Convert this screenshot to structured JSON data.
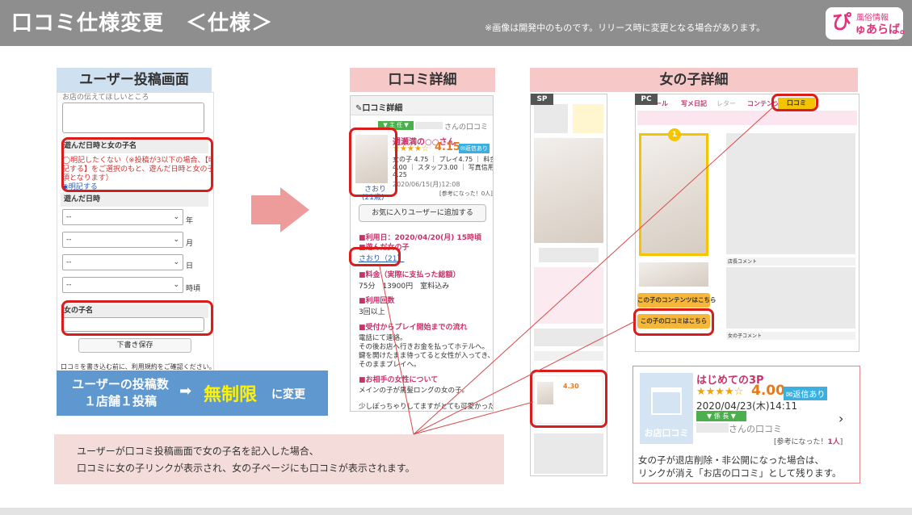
{
  "header": {
    "title": "口コミ仕様変更　＜仕様＞",
    "note": "※画像は開発中のものです。リリース時に変更となる場合があります。",
    "logo": {
      "big": "ぴ",
      "small": "風俗情報",
      "name": "ゅあらば。"
    }
  },
  "left": {
    "label": "ユーザー投稿画面",
    "top_cut_text": "お店の伝えてほしいところ",
    "visit_section_title": "遊んだ日時と女の子名",
    "radio_opt1": "◯明記したくない（※投稿が3以下の場合、【明",
    "radio_opt1_b": "記する】をご選択のもと、遊んだ日時と女の子名が必",
    "radio_opt1_c": "須となります）",
    "radio_opt2": "◉明記する",
    "date_title": "遊んだ日時",
    "selects": [
      {
        "value": "--",
        "unit": "年"
      },
      {
        "value": "--",
        "unit": "月"
      },
      {
        "value": "--",
        "unit": "日"
      },
      {
        "value": "--",
        "unit": "時頃"
      }
    ],
    "girl_name_title": "女の子名",
    "draft_button": "下書き保存",
    "footer_text": "口コミを書き込む前に、利用規約をご確認ください。",
    "banner_line1": "ユーザーの投稿数",
    "banner_line2": "１店舗１投稿",
    "banner_arrow": "➡",
    "banner_emph": "無制限",
    "banner_suffix": "に変更"
  },
  "middle": {
    "label": "口コミ詳細",
    "panel_title": "口コミ詳細",
    "badge": "▼ 主 任 ▼",
    "reviewer_suffix": "さんの口コミ",
    "shop_name": "週瀬満の○○さん",
    "stars": "★★★★☆",
    "score": "4.15",
    "reply_badge": "✉返信あり",
    "detail_line1": "女の子 4.75 ｜ プレイ4.75 ｜ 料金",
    "detail_line2": "4.00 ｜ スタッフ3.00 ｜ 写真信用度",
    "detail_line3": "4.25",
    "date": "2020/06/15(月)12:08",
    "helpful": "[参考になった！0人]",
    "thumb_name": "さおり",
    "thumb_age": "(21歳)",
    "favorite_button": "お気に入りユーザーに追加する",
    "use_date": "■利用日：2020/04/20(月) 15時頃",
    "played_girl_title": "■遊んだ女の子",
    "played_girl_link": "さおり（21）",
    "fee_title": "■料金（実際に支払った総額）",
    "fee_value": "75分　13900円　室料込み",
    "times_title": "■利用回数",
    "times_value": "3回以上",
    "flow_title": "■受付からプレイ開始までの流れ",
    "flow_text1": "電話にて連絡。",
    "flow_text2": "その後お店へ行きお金を払ってホテルへ。",
    "flow_text3": "鍵を開けたまま待ってると女性が入ってき、",
    "flow_text4": "そのままプレイへ。",
    "partner_title": "■お相手の女性について",
    "partner_text1": "メインの子が黒髪ロングの女の子。",
    "partner_text2": "少しぽっちゃりしてますがとても可愛かった"
  },
  "right": {
    "label": "女の子詳細",
    "sp_tag": "SP",
    "pc_tag": "PC",
    "pc_tabs": [
      "ール",
      "写メ日記",
      "レター",
      "コンテンツ",
      "口コミ"
    ],
    "pc_contents_button": "この子のコンテンツはこちら",
    "pc_review_button": "この子の口コミはこちら",
    "shop_comment": "店長コメント",
    "girl_comment": "女の子コメント",
    "card_title": "はじめての3P",
    "card_stars": "★★★★☆",
    "card_score": "4.00",
    "card_reply": "✉返信あり",
    "card_date": "2020/04/23(木)14:11",
    "card_badge": "▼ 係 長 ▼",
    "card_reviewer_suffix": "さんの口コミ",
    "card_helpful": "[参考になった！",
    "card_helpful_count": "1人",
    "card_helpful_end": "]",
    "card_shop_label": "お店口コミ",
    "card_note_line1": "女の子が退店削除・非公開になった場合は、",
    "card_note_line2": "リンクが消え「お店の口コミ」として残ります。"
  },
  "bottom_note": {
    "line1": "ユーザーが口コミ投稿画面で女の子名を記入した場合、",
    "line2": "口コミに女の子リンクが表示され、女の子ページにも口コミが表示されます。"
  },
  "colors": {
    "accent_red": "#d91c1c",
    "pink_label": "#f6c8c8",
    "blue_label": "#cfe0f1",
    "banner_blue": "#5f98cf",
    "highlight_yellow": "#fff200",
    "brand_pink": "#e2337c"
  }
}
